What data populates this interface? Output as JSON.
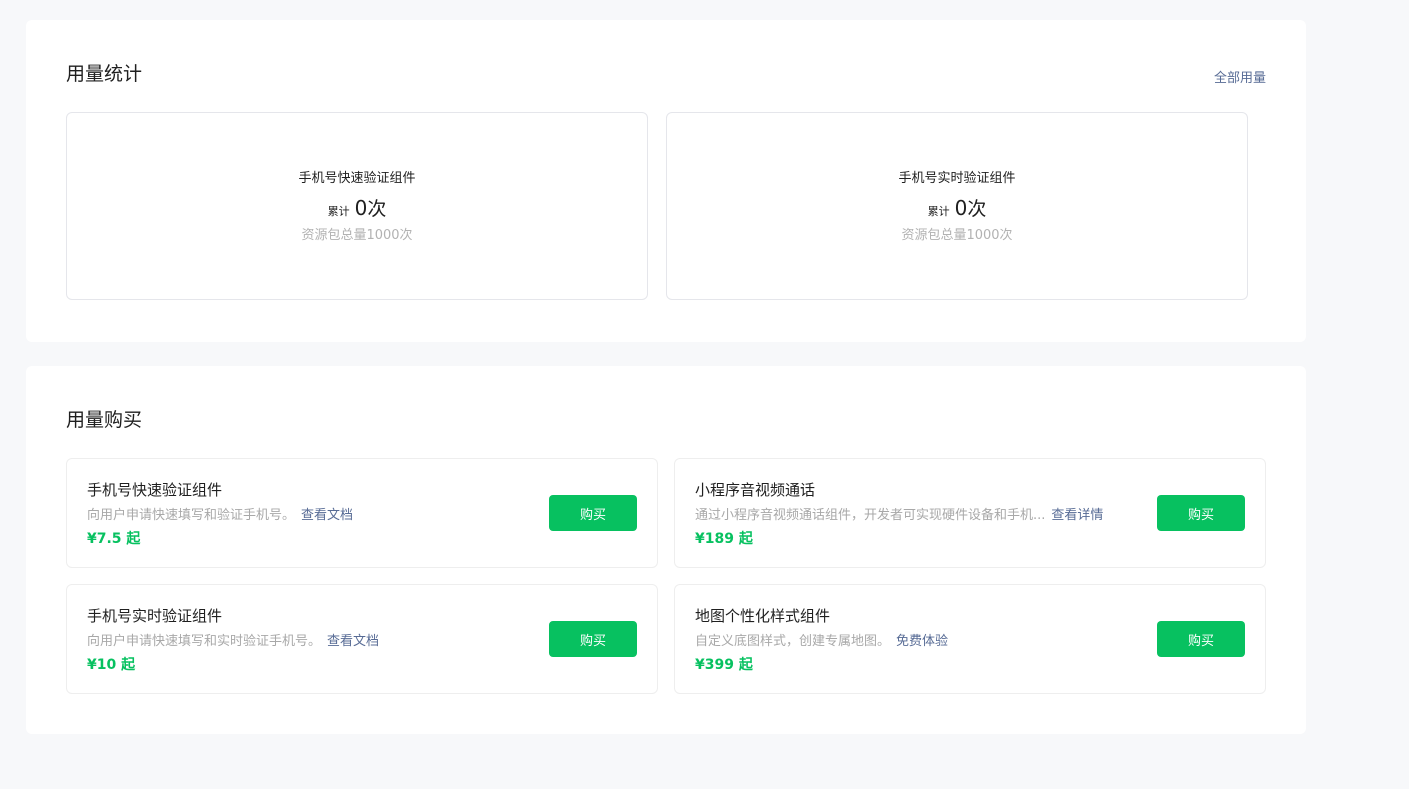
{
  "usage": {
    "title": "用量统计",
    "all_link": "全部用量",
    "cards": [
      {
        "name": "手机号快速验证组件",
        "count_label": "累计",
        "count": "0",
        "count_unit": "次",
        "total": "资源包总量1000次"
      },
      {
        "name": "手机号实时验证组件",
        "count_label": "累计",
        "count": "0",
        "count_unit": "次",
        "total": "资源包总量1000次"
      }
    ]
  },
  "purchase": {
    "title": "用量购买",
    "items": [
      {
        "name": "手机号快速验证组件",
        "desc": "向用户申请快速填写和验证手机号。",
        "link": "查看文档",
        "price": "¥7.5 起",
        "button": "购买"
      },
      {
        "name": "小程序音视频通话",
        "desc": "通过小程序音视频通话组件，开发者可实现硬件设备和手机...",
        "link": "查看详情",
        "price": "¥189 起",
        "button": "购买"
      },
      {
        "name": "手机号实时验证组件",
        "desc": "向用户申请快速填写和实时验证手机号。",
        "link": "查看文档",
        "price": "¥10 起",
        "button": "购买"
      },
      {
        "name": "地图个性化样式组件",
        "desc": "自定义底图样式，创建专属地图。",
        "link": "免费体验",
        "price": "¥399 起",
        "button": "购买"
      }
    ]
  },
  "colors": {
    "accent": "#07c160",
    "link": "#576b95",
    "page_bg": "#f7f8fa"
  }
}
